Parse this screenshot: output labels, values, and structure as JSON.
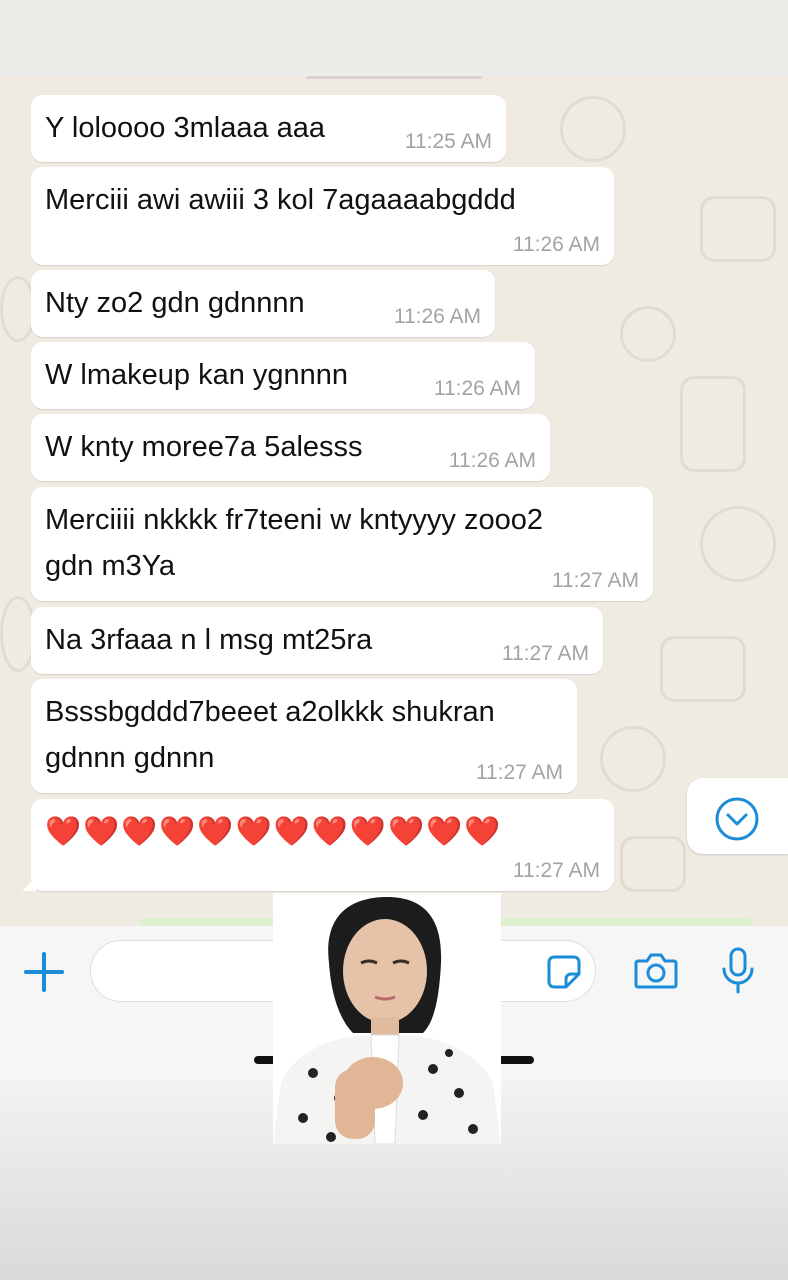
{
  "messages": [
    {
      "text": "Y loloooo 3mlaaa aaa",
      "time": "11:25 AM"
    },
    {
      "text": "Merciii awi awiii 3 kol 7agaaaabgddd",
      "time": "11:26 AM"
    },
    {
      "text": "Nty zo2 gdn gdnnnn",
      "time": "11:26 AM"
    },
    {
      "text": "W lmakeup kan ygnnnn",
      "time": "11:26 AM"
    },
    {
      "text": "W knty moree7a 5alesss",
      "time": "11:26 AM"
    },
    {
      "text_line1": "Merciiii nkkkk fr7teeni w kntyyyy zooo2",
      "text_line2": "gdn m3Ya",
      "time": "11:27 AM"
    },
    {
      "text": "Na 3rfaaa n l msg mt25ra",
      "time": "11:27 AM"
    },
    {
      "text_line1": "Bsssbgddd7beeet a2olkkk shukran",
      "text_line2": "gdnnn gdnnn",
      "time": "11:27 AM"
    },
    {
      "text": "❤️❤️❤️❤️❤️❤️❤️❤️❤️❤️❤️❤️",
      "time": "11:27 AM"
    }
  ],
  "input": {
    "placeholder": "",
    "value": ""
  },
  "icons": {
    "add": "plus-icon",
    "sticker": "sticker-icon",
    "camera": "camera-icon",
    "mic": "microphone-icon",
    "scroll_down": "chevron-down-circle-icon"
  },
  "colors": {
    "accent": "#1a8cd8",
    "chat_bg": "#efeae2",
    "bubble": "#ffffff",
    "time": "#a3a3a3"
  }
}
